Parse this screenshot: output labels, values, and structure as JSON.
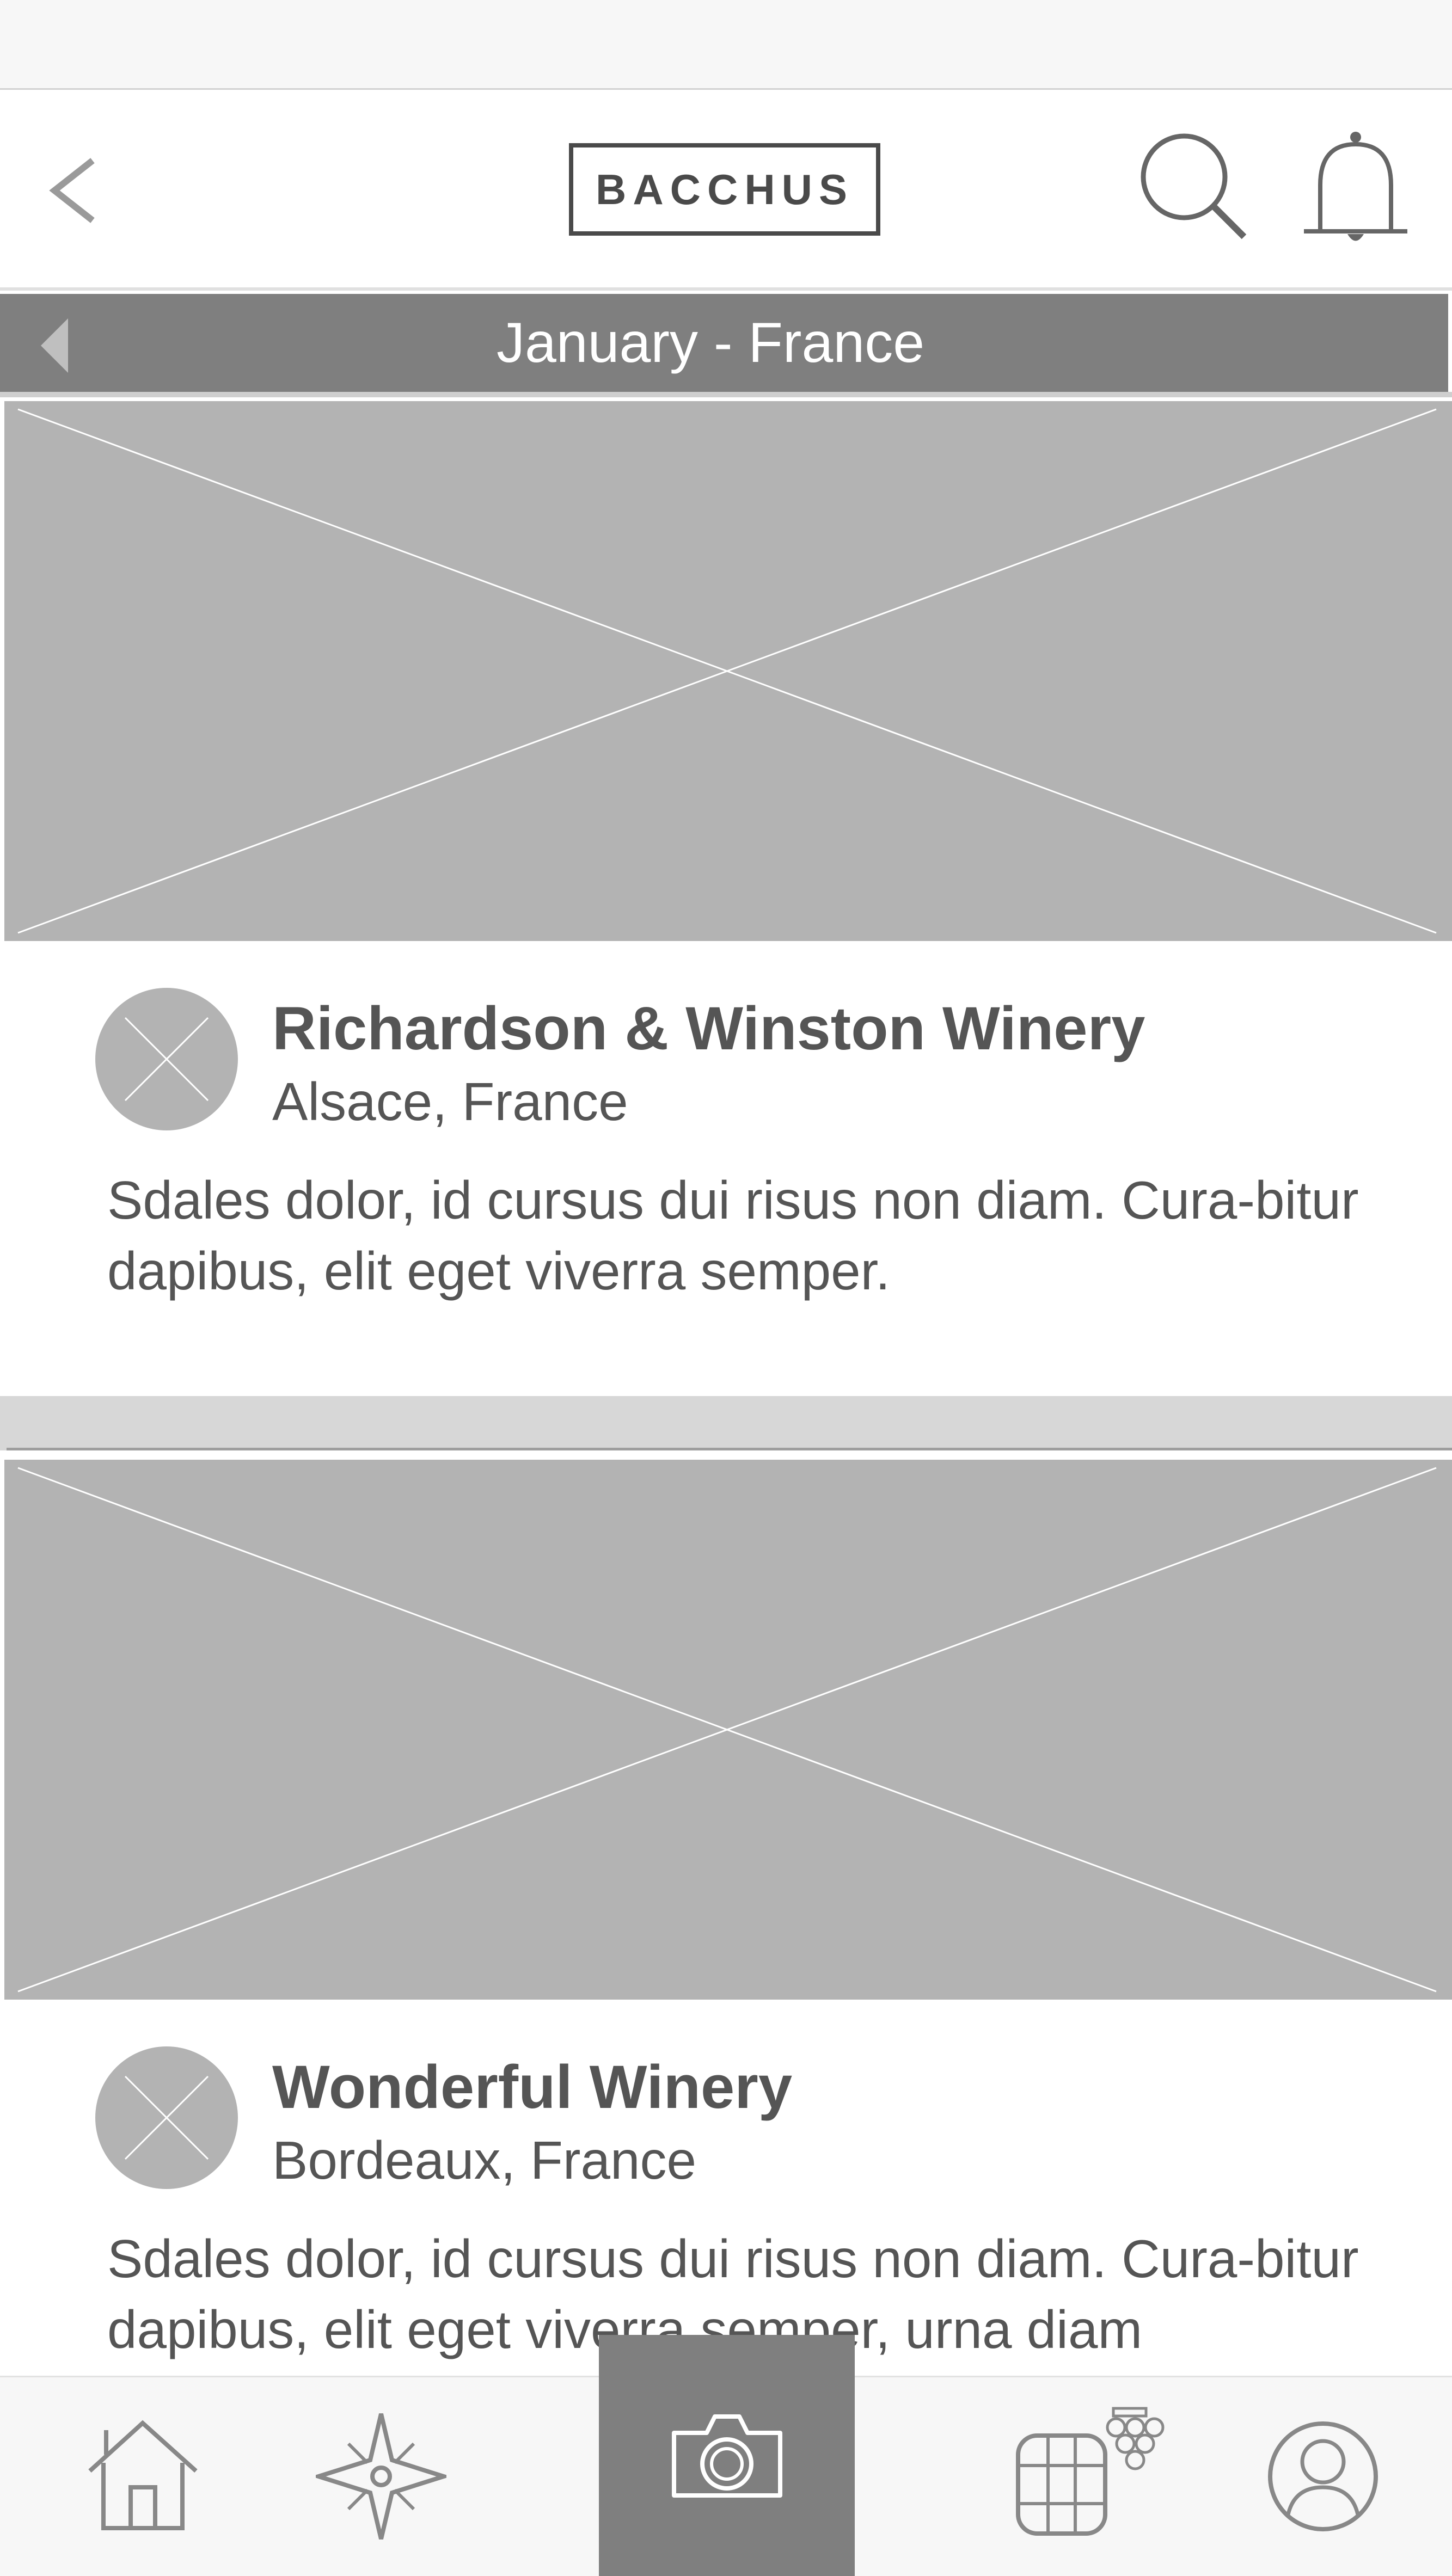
{
  "header": {
    "logo_text": "BACCHUS"
  },
  "month_bar": {
    "title": "January - France"
  },
  "posts": [
    {
      "winery_name": "Richardson & Winston Winery",
      "location": "Alsace, France",
      "description": "Sdales dolor, id cursus dui risus non diam. Cura-bitur dapibus, elit eget viverra semper."
    },
    {
      "winery_name": "Wonderful Winery",
      "location": "Bordeaux, France",
      "description": "Sdales dolor, id cursus dui risus non diam. Cura-bitur dapibus, elit eget viverra semper, urna diam"
    }
  ],
  "icons": {
    "header": [
      "back-chevron-icon",
      "search-icon",
      "bell-icon"
    ],
    "month_bar": [
      "triangle-left-icon"
    ],
    "bottom_nav": [
      "home-icon",
      "compass-icon",
      "camera-icon",
      "barrel-grapes-icon",
      "profile-icon"
    ]
  },
  "colors": {
    "nav_gray": "#7f7f7f",
    "placeholder_gray": "#b3b3b3",
    "text_gray": "#555555"
  }
}
